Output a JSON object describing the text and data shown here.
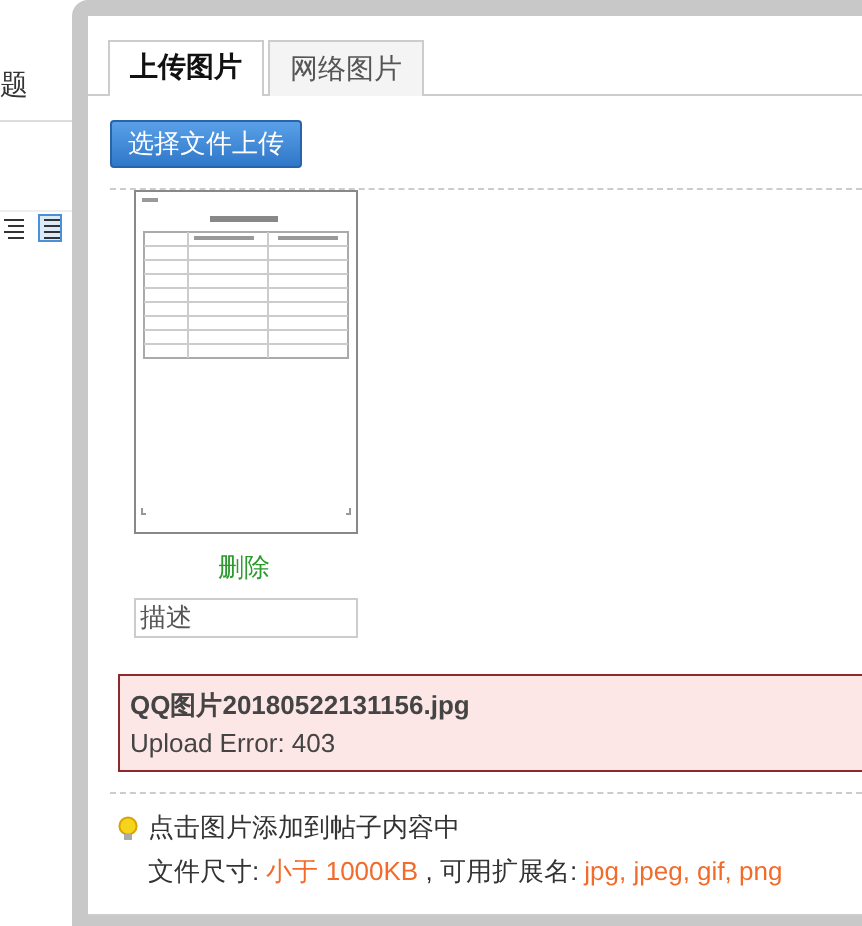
{
  "background_page": {
    "title_fragment": "题"
  },
  "tabs": [
    {
      "label": "上传图片",
      "selected": true
    },
    {
      "label": "网络图片",
      "selected": false
    }
  ],
  "upload_button": "选择文件上传",
  "thumbnail": {
    "delete_link": "删除",
    "description": {
      "placeholder": "描述"
    }
  },
  "error": {
    "file_name": "QQ图片20180522131156.jpg",
    "message": "Upload Error: 403"
  },
  "tips": {
    "line_1": "点击图片添加到帖子内容中",
    "size_label": "文件尺寸: ",
    "size_value": "小于 1000KB",
    "ext_label": " , 可用扩展名: ",
    "ext_value": "jpg, jpeg, gif, png"
  }
}
